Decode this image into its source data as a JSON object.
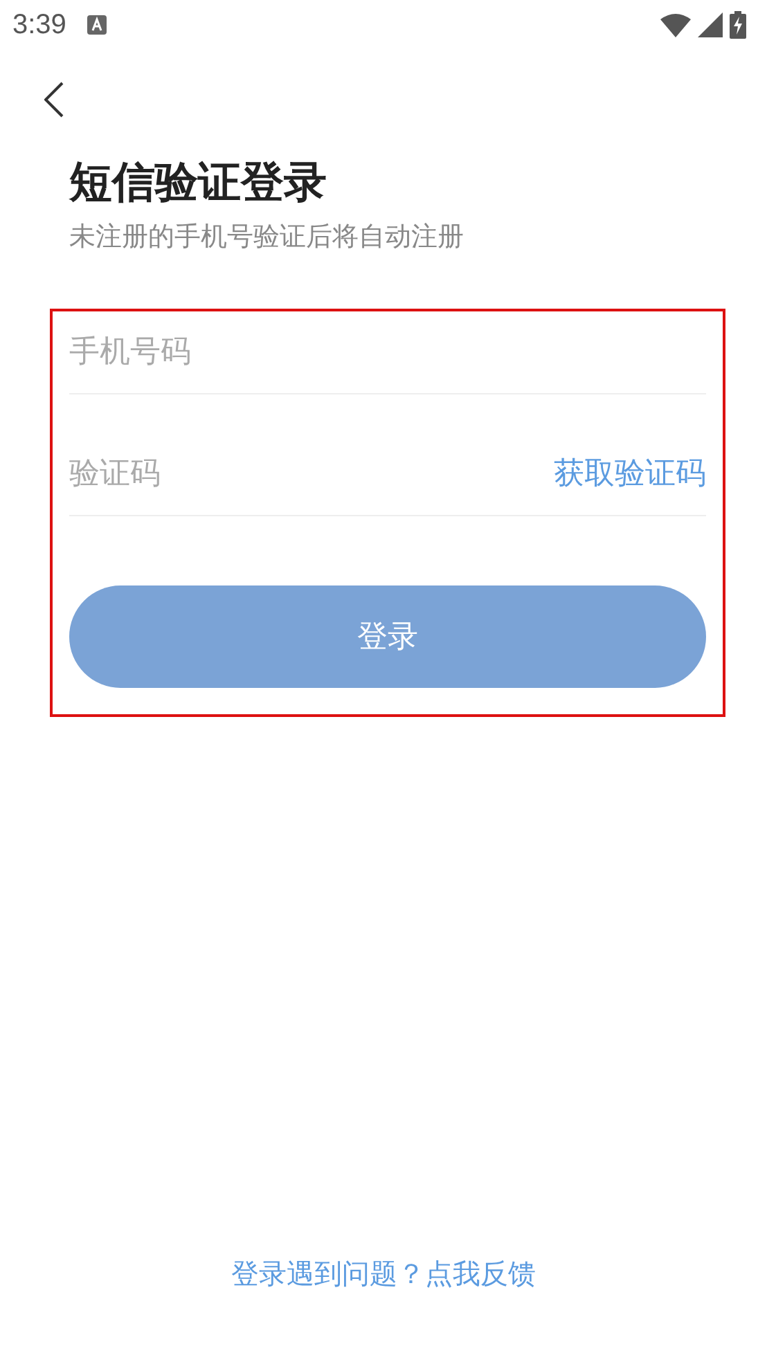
{
  "status_bar": {
    "time": "3:39"
  },
  "title": "短信验证登录",
  "subtitle": "未注册的手机号验证后将自动注册",
  "phone_field": {
    "placeholder": "手机号码"
  },
  "code_field": {
    "placeholder": "验证码",
    "action": "获取验证码"
  },
  "login_button": {
    "label": "登录",
    "disabled": true
  },
  "feedback_link": "登录遇到问题？点我反馈"
}
